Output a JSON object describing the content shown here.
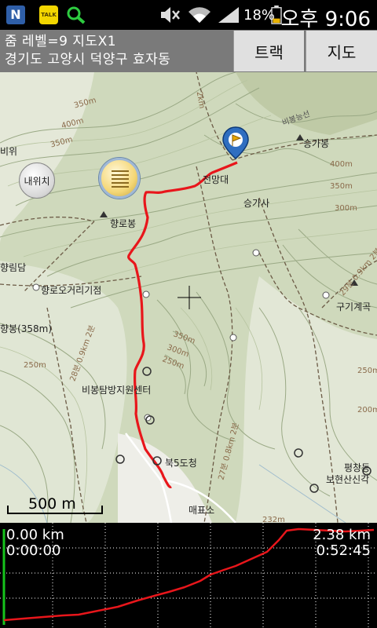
{
  "status_bar": {
    "notification_n": "N",
    "notification_talk": "TALK",
    "battery_percent": "18%",
    "time": "오후 9:06",
    "icons": [
      "naver-icon",
      "kakaotalk-icon",
      "search-icon",
      "mute-icon",
      "wifi-icon",
      "signal-icon",
      "battery-icon"
    ]
  },
  "header": {
    "zoom_info": "줌 레벨=9 지도X1",
    "address": "경기도 고양시 덕양구 효자동",
    "track_button": "트랙",
    "map_button": "지도"
  },
  "map": {
    "my_location_button": "내위치",
    "scale_label": "500 m",
    "labels": {
      "jeonmangdae": "전망대",
      "seunggasa": "승가사",
      "seungabong": "승가봉",
      "birongneungseon": "비봉능선",
      "hyangrobong": "향로봉",
      "hyangro_junction": "향로오거리기점",
      "birong_center": "비봉탐방지원센터",
      "bukhando_chung": "북5도청",
      "maepyoso": "매표소",
      "gugi_valley": "구기계곡",
      "pyeongchang": "평창동",
      "bohyeon": "보현산신각",
      "hyangrimdam": "향림담",
      "biwi": "비위",
      "hyangbong": "향봉(358m)",
      "contour_400": "400m",
      "contour_350": "350m",
      "contour_300": "300m",
      "contour_250": "250m",
      "contour_200": "200m",
      "peak_232": "232m",
      "trail_a": "2km",
      "trail_b": "29분 0.9km 2분",
      "trail_c": "27분 0.8km 2분",
      "trail_d": "28분 0.9km 2분"
    }
  },
  "profile": {
    "start_distance": "0.00 km",
    "start_time": "0:00:00",
    "end_distance": "2.38 km",
    "end_time": "0:52:45"
  },
  "colors": {
    "track": "#e8161b",
    "map_bg": "#cfd9bc",
    "header_bg": "#7a7a7a",
    "profile_bg": "#000000",
    "profile_marker": "#16c41b"
  }
}
